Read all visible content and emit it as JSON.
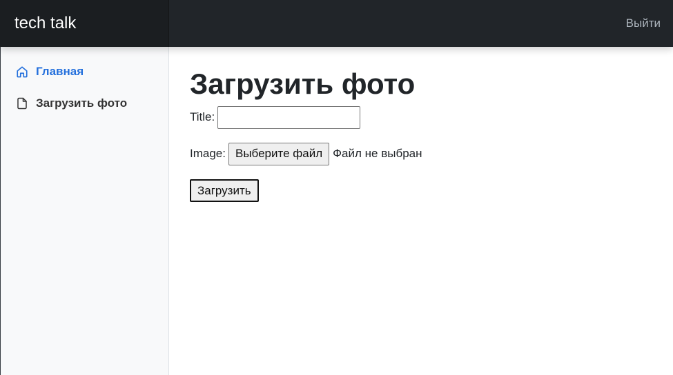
{
  "header": {
    "brand": "tech talk",
    "signout_label": "Выйти"
  },
  "sidebar": {
    "items": [
      {
        "label": "Главная",
        "icon": "home-icon",
        "active": true
      },
      {
        "label": "Загрузить фото",
        "icon": "file-icon",
        "active": false
      }
    ]
  },
  "main": {
    "title": "Загрузить фото",
    "form": {
      "title_label": "Title:",
      "title_value": "",
      "image_label": "Image:",
      "file_button_label": "Выберите файл",
      "file_status": "Файл не выбран",
      "submit_label": "Загрузить"
    }
  },
  "colors": {
    "navbar": "#212529",
    "brand_bg": "#1b1e21",
    "sidebar_bg": "#f8f9fa",
    "active_link": "#2470dc"
  }
}
